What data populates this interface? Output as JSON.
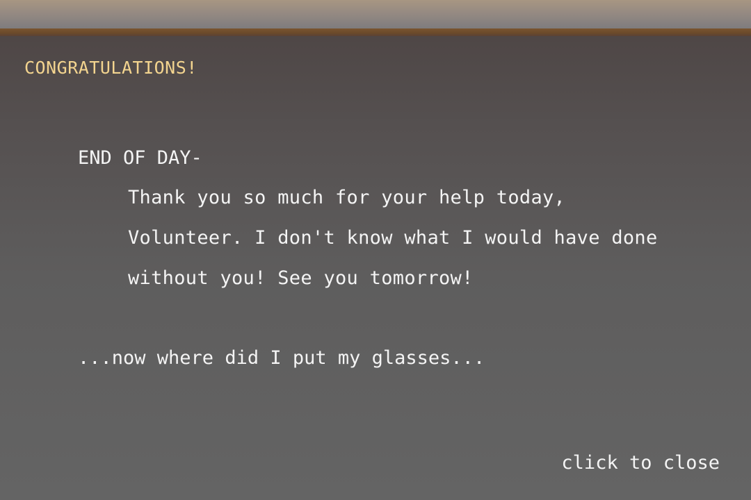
{
  "dialog": {
    "heading": "CONGRATULATIONS!",
    "letter": {
      "title": "END OF DAY-",
      "lines": [
        "Thank you so much for your help today,",
        "Volunteer. I don't know what I would have done",
        "without you! See you tomorrow!"
      ]
    },
    "postscript": "...now where did I put my glasses...",
    "close_label": "click to close"
  },
  "colors": {
    "heading": "#f3d48f",
    "body_text": "#f4f4f4",
    "border": "#6b4a2a"
  }
}
